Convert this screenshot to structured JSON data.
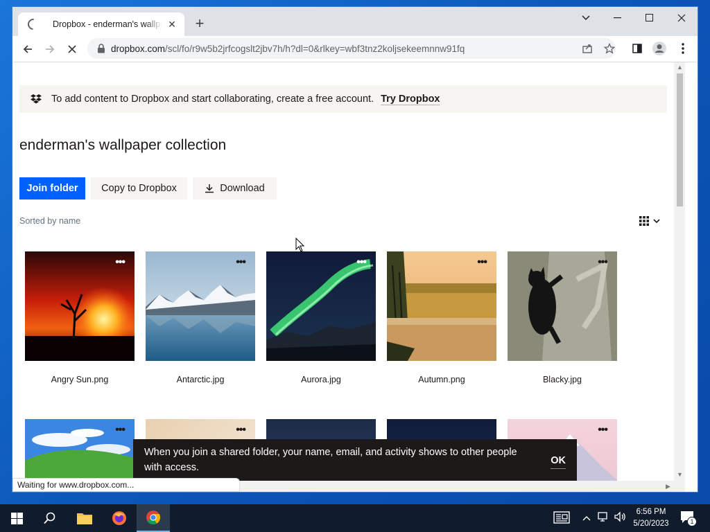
{
  "browser": {
    "tab_title": "Dropbox - enderman's wallpaper collection",
    "tab_close": "✕",
    "new_tab": "+",
    "url_host": "dropbox.com",
    "url_path": "/scl/fo/r9w5b2jrfcogslt2jbv7h/h?dl=0&rlkey=wbf3tnz2koljsekeemnnw91fq",
    "status_text": "Waiting for www.dropbox.com..."
  },
  "banner": {
    "text": "To add content to Dropbox and start collaborating, create a free account.",
    "link": "Try Dropbox"
  },
  "folder": {
    "title": "enderman's wallpaper collection",
    "join_label": "Join folder",
    "copy_label": "Copy to Dropbox",
    "download_label": "Download",
    "sorted_label": "Sorted by name"
  },
  "files": [
    {
      "name": "Angry Sun.png"
    },
    {
      "name": "Antarctic.jpg"
    },
    {
      "name": "Aurora.jpg"
    },
    {
      "name": "Autumn.png"
    },
    {
      "name": "Blacky.jpg"
    }
  ],
  "toast": {
    "message": "When you join a shared folder, your name, email, and activity shows to other people with access.",
    "ok_label": "OK"
  },
  "taskbar": {
    "time": "6:56 PM",
    "date": "5/20/2023",
    "notification_count": "1"
  },
  "colors": {
    "accent": "#0061fe",
    "banner_bg": "#f7f5f2",
    "toast_bg": "#1e1919"
  }
}
